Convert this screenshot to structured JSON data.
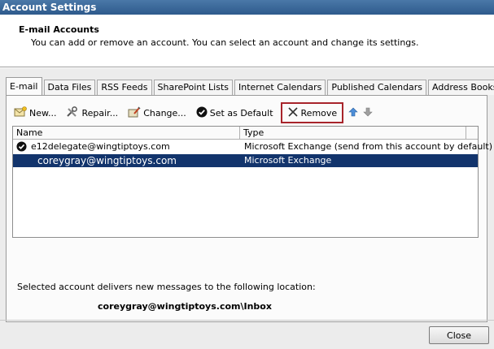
{
  "window": {
    "title": "Account Settings"
  },
  "header": {
    "title": "E-mail Accounts",
    "description": "You can add or remove an account. You can select an account and change its settings."
  },
  "tabs": [
    {
      "label": "E-mail",
      "active": true
    },
    {
      "label": "Data Files"
    },
    {
      "label": "RSS Feeds"
    },
    {
      "label": "SharePoint Lists"
    },
    {
      "label": "Internet Calendars"
    },
    {
      "label": "Published Calendars"
    },
    {
      "label": "Address Books"
    }
  ],
  "toolbar": {
    "new_label": "New...",
    "repair_label": "Repair...",
    "change_label": "Change...",
    "set_default_label": "Set as Default",
    "remove_label": "Remove"
  },
  "list": {
    "columns": {
      "name": "Name",
      "type": "Type"
    },
    "rows": [
      {
        "name": "e12delegate@wingtiptoys.com",
        "type": "Microsoft Exchange (send from this account by default)",
        "default": true
      },
      {
        "name": "coreygray@wingtiptoys.com",
        "type": "Microsoft Exchange",
        "selected": true
      }
    ]
  },
  "delivery": {
    "label": "Selected account delivers new messages to the following location:",
    "path": "coreygray@wingtiptoys.com\\Inbox"
  },
  "footer": {
    "close_label": "Close"
  },
  "colors": {
    "selection": "#12346c",
    "highlight_border": "#a8242b",
    "titlebar": "#2e5a8c"
  }
}
